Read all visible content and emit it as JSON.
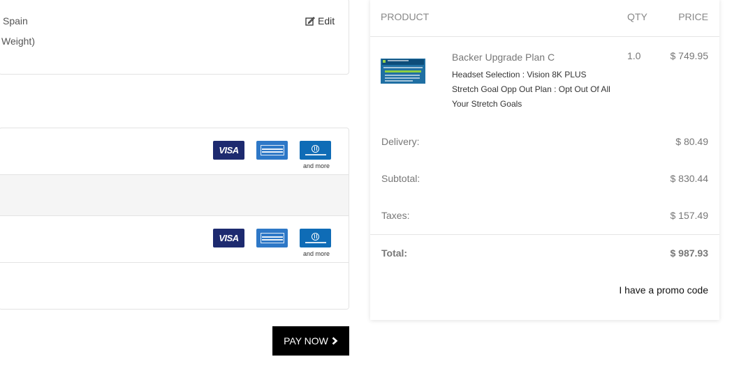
{
  "shipping": {
    "address_line": "Spain",
    "method_line": "Weight)",
    "edit_label": "Edit"
  },
  "payment": {
    "row1": {
      "cards": [
        "VISA"
      ],
      "more_label": "and more"
    },
    "row2": {
      "cards": [
        "VISA"
      ],
      "more_label": "and more"
    },
    "pay_button_label": "PAY NOW"
  },
  "summary": {
    "headers": {
      "product": "PRODUCT",
      "qty": "QTY",
      "price": "PRICE"
    },
    "item": {
      "name": "Backer Upgrade Plan C",
      "options": [
        "Headset Selection : Vision 8K PLUS",
        "Stretch Goal Opp Out Plan : Opt Out Of All Your Stretch Goals"
      ],
      "qty": "1.0",
      "price": "$ 749.95"
    },
    "delivery": {
      "label": "Delivery:",
      "value": "$ 80.49"
    },
    "subtotal": {
      "label": "Subtotal:",
      "value": "$ 830.44"
    },
    "taxes": {
      "label": "Taxes:",
      "value": "$ 157.49"
    },
    "total": {
      "label": "Total:",
      "value": "$ 987.93"
    },
    "promo_label": "I have a promo code"
  },
  "icons": [
    "edit-icon",
    "visa-card-icon",
    "amex-card-icon",
    "diners-club-card-icon",
    "chevron-right-icon"
  ],
  "colors": {
    "pay_button": "#000000",
    "visa": "#1d2a6f",
    "amex": "#2e78c7",
    "diners": "#0f6cb6"
  }
}
